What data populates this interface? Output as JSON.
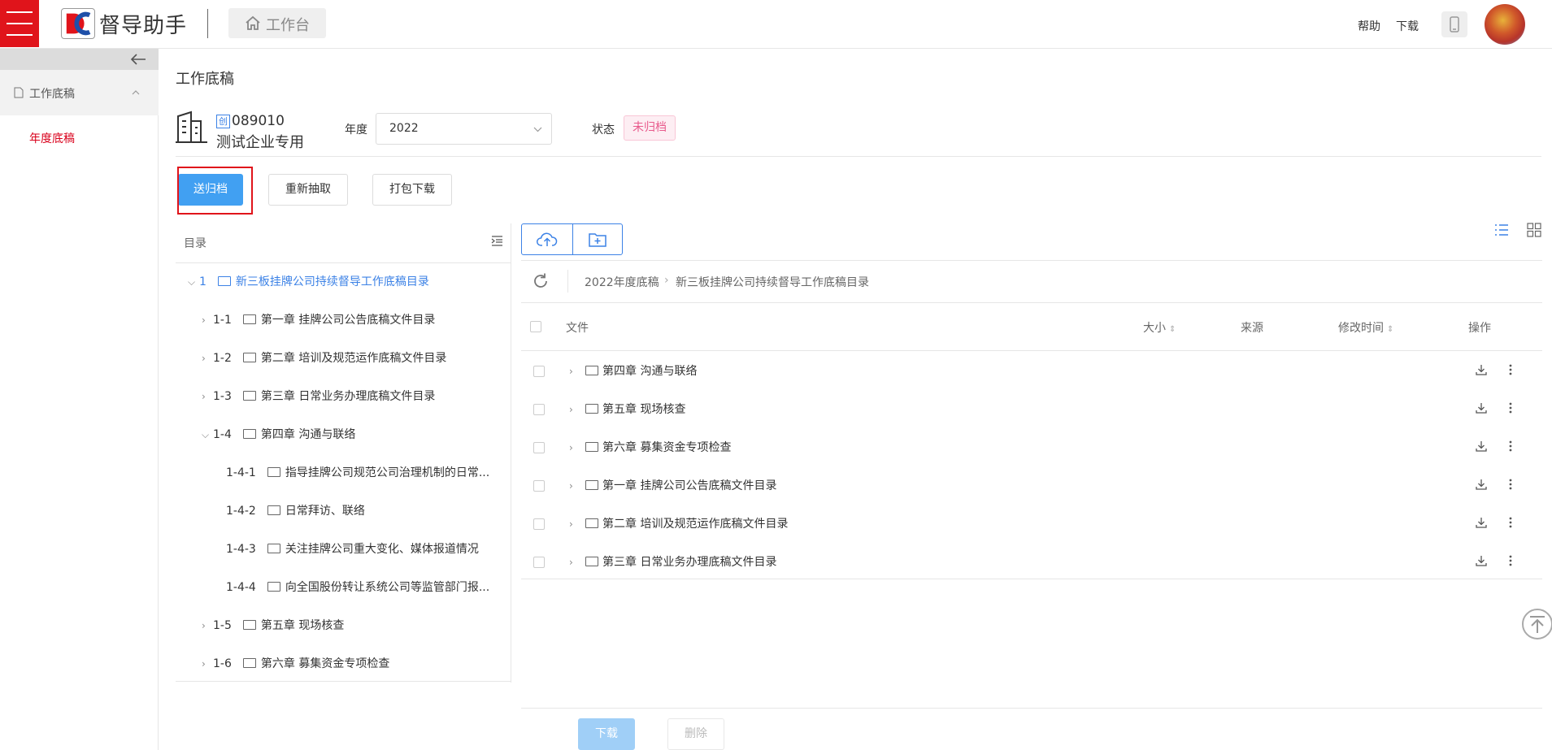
{
  "header": {
    "app_name": "督导助手",
    "workbench_label": "工作台",
    "help_label": "帮助",
    "download_label": "下载",
    "brand_color": "#e0141b"
  },
  "sidebar": {
    "group_label": "工作底稿",
    "items": [
      {
        "label": "年度底稿"
      }
    ]
  },
  "main": {
    "title": "工作底稿",
    "company": {
      "code_tag": "创",
      "code": "089010",
      "name": "测试企业专用"
    },
    "year_label": "年度",
    "year_value": "2022",
    "status_label": "状态",
    "status_value": "未归档",
    "buttons": {
      "archive": "送归档",
      "reextract": "重新抽取",
      "pack_download": "打包下载"
    }
  },
  "tree": {
    "header": "目录",
    "items": [
      {
        "num": "1",
        "label": "新三板挂牌公司持续督导工作底稿目录"
      },
      {
        "num": "1-1",
        "label": "第一章 挂牌公司公告底稿文件目录"
      },
      {
        "num": "1-2",
        "label": "第二章 培训及规范运作底稿文件目录"
      },
      {
        "num": "1-3",
        "label": "第三章 日常业务办理底稿文件目录"
      },
      {
        "num": "1-4",
        "label": "第四章 沟通与联络"
      },
      {
        "num": "1-4-1",
        "label": "指导挂牌公司规范公司治理机制的日常..."
      },
      {
        "num": "1-4-2",
        "label": "日常拜访、联络"
      },
      {
        "num": "1-4-3",
        "label": "关注挂牌公司重大变化、媒体报道情况"
      },
      {
        "num": "1-4-4",
        "label": "向全国股份转让系统公司等监管部门报..."
      },
      {
        "num": "1-5",
        "label": "第五章 现场核查"
      },
      {
        "num": "1-6",
        "label": "第六章 募集资金专项检查"
      }
    ]
  },
  "files": {
    "breadcrumb": [
      "2022年度底稿",
      "新三板挂牌公司持续督导工作底稿目录"
    ],
    "columns": {
      "file": "文件",
      "size": "大小",
      "source": "来源",
      "modified": "修改时间",
      "actions": "操作"
    },
    "rows": [
      {
        "name": "第四章 沟通与联络"
      },
      {
        "name": "第五章 现场核查"
      },
      {
        "name": "第六章 募集资金专项检查"
      },
      {
        "name": "第一章 挂牌公司公告底稿文件目录"
      },
      {
        "name": "第二章 培训及规范运作底稿文件目录"
      },
      {
        "name": "第三章 日常业务办理底稿文件目录"
      }
    ],
    "footer": {
      "download": "下载",
      "delete": "删除"
    }
  }
}
